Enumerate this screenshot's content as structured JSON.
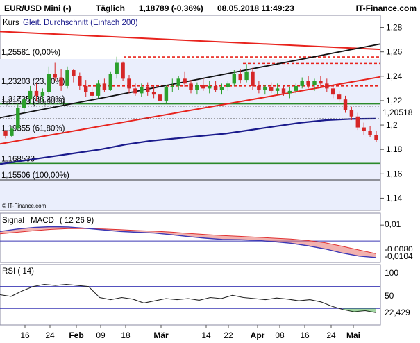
{
  "header": {
    "instrument": "EUR/USD Mini (-)",
    "interval": "Täglich",
    "quote": "1,18789 (-0,36%)",
    "timestamp": "08.05.2018 11:49:23",
    "brand": "IT-Finance.com"
  },
  "legend": {
    "kurs": "Kurs",
    "ma": "Gleit. Durchschnitt (Einfach 200)"
  },
  "source_note": "© IT-Finance.com",
  "fib_levels": [
    {
      "label": "1,25581 (0,00%)",
      "value": 1.25581
    },
    {
      "label": "1,23203 (23,60%)",
      "value": 1.23203
    },
    {
      "label": "1,21735 (38,20%)",
      "value": 1.21735
    },
    {
      "label": "1,21543 (50,00%)",
      "value": 1.21543
    },
    {
      "label": "1,19355 (61,80%)",
      "value": 1.19355
    },
    {
      "label": "1,168533",
      "value": 1.168533
    },
    {
      "label": "1,15506 (100,00%)",
      "value": 1.15506
    }
  ],
  "macd_panel": {
    "signal_label": "Signal",
    "macd_label": "MACD",
    "params": "( 12 26 9)",
    "tick_upper": "0,01",
    "tick_lower": "-0,01",
    "signal_value": "-0,0080",
    "macd_value": "-0,0104"
  },
  "rsi_panel": {
    "label": "RSI ( 14)",
    "tick_100": "100",
    "tick_50": "50",
    "value": "22,429"
  },
  "colors": {
    "up": "#2ca02c",
    "down": "#d62728",
    "ma": "#1a1a8c",
    "trend_red": "#e8231d",
    "trend_black": "#111111",
    "support": "#2a8a2a",
    "panel_bg": "#eaeefc",
    "macd": "#3b38b5",
    "signal": "#e8726d"
  },
  "chart_data": [
    {
      "type": "candlestick",
      "title": "EUR/USD Mini (-) Täglich",
      "x_ticks": [
        "16",
        "24",
        "Feb",
        "09",
        "18",
        "Mär",
        "14",
        "22",
        "Apr",
        "08",
        "16",
        "24",
        "Mai"
      ],
      "y_ticks": [
        "1,28",
        "1,26",
        "1,24",
        "1,22",
        "1,2",
        "1,18",
        "1,16",
        "1,14"
      ],
      "ylim": [
        1.13,
        1.29
      ],
      "last_price_label": "1,20518",
      "ma200_series": [
        1.168,
        1.171,
        1.174,
        1.177,
        1.18,
        1.184,
        1.187,
        1.189,
        1.191,
        1.193,
        1.196,
        1.199,
        1.202,
        1.204,
        1.205,
        1.2052
      ],
      "candles": [
        {
          "o": 1.195,
          "h": 1.196,
          "l": 1.189,
          "c": 1.191
        },
        {
          "o": 1.191,
          "h": 1.199,
          "l": 1.19,
          "c": 1.197
        },
        {
          "o": 1.197,
          "h": 1.217,
          "l": 1.196,
          "c": 1.214
        },
        {
          "o": 1.214,
          "h": 1.224,
          "l": 1.21,
          "c": 1.221
        },
        {
          "o": 1.221,
          "h": 1.232,
          "l": 1.218,
          "c": 1.228
        },
        {
          "o": 1.228,
          "h": 1.234,
          "l": 1.22,
          "c": 1.224
        },
        {
          "o": 1.224,
          "h": 1.23,
          "l": 1.219,
          "c": 1.227
        },
        {
          "o": 1.227,
          "h": 1.248,
          "l": 1.225,
          "c": 1.242
        },
        {
          "o": 1.242,
          "h": 1.251,
          "l": 1.236,
          "c": 1.239
        },
        {
          "o": 1.239,
          "h": 1.246,
          "l": 1.228,
          "c": 1.232
        },
        {
          "o": 1.232,
          "h": 1.248,
          "l": 1.23,
          "c": 1.245
        },
        {
          "o": 1.245,
          "h": 1.246,
          "l": 1.235,
          "c": 1.24
        },
        {
          "o": 1.24,
          "h": 1.243,
          "l": 1.229,
          "c": 1.232
        },
        {
          "o": 1.232,
          "h": 1.237,
          "l": 1.223,
          "c": 1.227
        },
        {
          "o": 1.227,
          "h": 1.23,
          "l": 1.221,
          "c": 1.224
        },
        {
          "o": 1.224,
          "h": 1.237,
          "l": 1.222,
          "c": 1.234
        },
        {
          "o": 1.234,
          "h": 1.238,
          "l": 1.227,
          "c": 1.229
        },
        {
          "o": 1.229,
          "h": 1.244,
          "l": 1.228,
          "c": 1.242
        },
        {
          "o": 1.242,
          "h": 1.256,
          "l": 1.238,
          "c": 1.251
        },
        {
          "o": 1.251,
          "h": 1.252,
          "l": 1.236,
          "c": 1.238
        },
        {
          "o": 1.238,
          "h": 1.241,
          "l": 1.226,
          "c": 1.23
        },
        {
          "o": 1.23,
          "h": 1.234,
          "l": 1.224,
          "c": 1.226
        },
        {
          "o": 1.226,
          "h": 1.234,
          "l": 1.223,
          "c": 1.231
        },
        {
          "o": 1.231,
          "h": 1.235,
          "l": 1.224,
          "c": 1.227
        },
        {
          "o": 1.227,
          "h": 1.233,
          "l": 1.222,
          "c": 1.225
        },
        {
          "o": 1.225,
          "h": 1.231,
          "l": 1.216,
          "c": 1.22
        },
        {
          "o": 1.22,
          "h": 1.233,
          "l": 1.218,
          "c": 1.231
        },
        {
          "o": 1.231,
          "h": 1.238,
          "l": 1.227,
          "c": 1.232
        },
        {
          "o": 1.232,
          "h": 1.24,
          "l": 1.229,
          "c": 1.238
        },
        {
          "o": 1.238,
          "h": 1.244,
          "l": 1.231,
          "c": 1.234
        },
        {
          "o": 1.234,
          "h": 1.237,
          "l": 1.226,
          "c": 1.229
        },
        {
          "o": 1.229,
          "h": 1.235,
          "l": 1.225,
          "c": 1.233
        },
        {
          "o": 1.233,
          "h": 1.238,
          "l": 1.228,
          "c": 1.23
        },
        {
          "o": 1.23,
          "h": 1.236,
          "l": 1.226,
          "c": 1.232
        },
        {
          "o": 1.232,
          "h": 1.236,
          "l": 1.227,
          "c": 1.229
        },
        {
          "o": 1.229,
          "h": 1.234,
          "l": 1.225,
          "c": 1.231
        },
        {
          "o": 1.231,
          "h": 1.236,
          "l": 1.228,
          "c": 1.234
        },
        {
          "o": 1.234,
          "h": 1.245,
          "l": 1.232,
          "c": 1.242
        },
        {
          "o": 1.242,
          "h": 1.246,
          "l": 1.234,
          "c": 1.237
        },
        {
          "o": 1.237,
          "h": 1.25,
          "l": 1.235,
          "c": 1.244
        },
        {
          "o": 1.244,
          "h": 1.247,
          "l": 1.229,
          "c": 1.232
        },
        {
          "o": 1.232,
          "h": 1.236,
          "l": 1.226,
          "c": 1.229
        },
        {
          "o": 1.229,
          "h": 1.233,
          "l": 1.225,
          "c": 1.231
        },
        {
          "o": 1.231,
          "h": 1.235,
          "l": 1.226,
          "c": 1.228
        },
        {
          "o": 1.228,
          "h": 1.234,
          "l": 1.225,
          "c": 1.23
        },
        {
          "o": 1.23,
          "h": 1.233,
          "l": 1.224,
          "c": 1.226
        },
        {
          "o": 1.226,
          "h": 1.231,
          "l": 1.222,
          "c": 1.228
        },
        {
          "o": 1.228,
          "h": 1.234,
          "l": 1.226,
          "c": 1.232
        },
        {
          "o": 1.232,
          "h": 1.239,
          "l": 1.23,
          "c": 1.236
        },
        {
          "o": 1.236,
          "h": 1.24,
          "l": 1.23,
          "c": 1.233
        },
        {
          "o": 1.233,
          "h": 1.238,
          "l": 1.228,
          "c": 1.236
        },
        {
          "o": 1.236,
          "h": 1.24,
          "l": 1.231,
          "c": 1.234
        },
        {
          "o": 1.234,
          "h": 1.238,
          "l": 1.227,
          "c": 1.23
        },
        {
          "o": 1.23,
          "h": 1.233,
          "l": 1.222,
          "c": 1.225
        },
        {
          "o": 1.225,
          "h": 1.228,
          "l": 1.219,
          "c": 1.221
        },
        {
          "o": 1.221,
          "h": 1.224,
          "l": 1.21,
          "c": 1.212
        },
        {
          "o": 1.212,
          "h": 1.215,
          "l": 1.204,
          "c": 1.207
        },
        {
          "o": 1.207,
          "h": 1.21,
          "l": 1.196,
          "c": 1.198
        },
        {
          "o": 1.198,
          "h": 1.202,
          "l": 1.192,
          "c": 1.195
        },
        {
          "o": 1.195,
          "h": 1.199,
          "l": 1.19,
          "c": 1.192
        },
        {
          "o": 1.192,
          "h": 1.195,
          "l": 1.186,
          "c": 1.1879
        }
      ]
    },
    {
      "type": "line",
      "title": "MACD ( 12 26 9)",
      "y_ticks": [
        "0,01",
        "-0,01"
      ],
      "ylim": [
        -0.0135,
        0.0175
      ],
      "series": [
        {
          "name": "MACD",
          "values": [
            0.006,
            0.0075,
            0.0085,
            0.009,
            0.0088,
            0.008,
            0.007,
            0.006,
            0.0055,
            0.005,
            0.004,
            0.0028,
            0.0018,
            0.001,
            0.0008,
            0.0004,
            -0.0004,
            -0.0014,
            -0.003,
            -0.005,
            -0.0075,
            -0.0095,
            -0.0104
          ]
        },
        {
          "name": "Signal",
          "values": [
            0.0045,
            0.0055,
            0.0065,
            0.0073,
            0.0078,
            0.0078,
            0.0076,
            0.0071,
            0.0066,
            0.0062,
            0.0056,
            0.0048,
            0.0041,
            0.0034,
            0.0029,
            0.0024,
            0.0018,
            0.0012,
            0.0003,
            -0.0011,
            -0.0033,
            -0.0057,
            -0.008
          ]
        }
      ]
    },
    {
      "type": "line",
      "title": "RSI ( 14)",
      "y_ticks": [
        "100",
        "50"
      ],
      "ylim": [
        0,
        110
      ],
      "series": [
        {
          "name": "RSI",
          "values": [
            55,
            52,
            62,
            70,
            74,
            72,
            74,
            72,
            70,
            50,
            46,
            50,
            47,
            40,
            44,
            48,
            46,
            48,
            45,
            50,
            48,
            54,
            50,
            48,
            46,
            49,
            47,
            44,
            46,
            42,
            34,
            28,
            24,
            26,
            22.429
          ]
        }
      ]
    }
  ]
}
